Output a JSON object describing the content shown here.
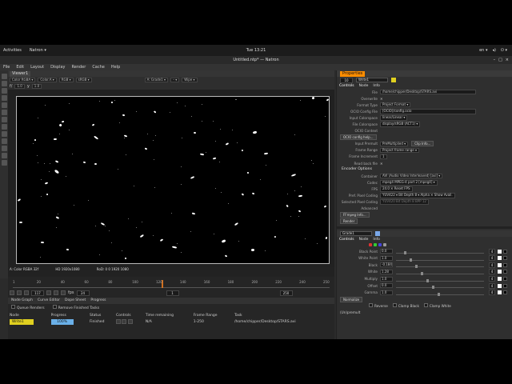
{
  "os_bar": {
    "activities": "Activities",
    "app_menu": "Natron ▾",
    "clock": "Tue 13:21",
    "tray": [
      "en ▾",
      "◂)",
      "⏻ ▾"
    ]
  },
  "window": {
    "title": "Untitled.ntp* — Natron",
    "buttons": [
      "–",
      "□",
      "×"
    ]
  },
  "menu": [
    "File",
    "Edit",
    "Layout",
    "Display",
    "Render",
    "Cache",
    "Help"
  ],
  "viewer": {
    "tab": "Viewer1",
    "row1": [
      "Color RGBA ▾",
      "Color.A ▾",
      "RGB ▾",
      "sRGB ▾"
    ],
    "row1_right": [
      "A: Grade1 ▾",
      "– ▾",
      "Wipe ▾"
    ],
    "row2": [
      "f/",
      "1.0",
      "y",
      "1.0"
    ],
    "info_left": "A: Color RGBA 32f",
    "info_mid": "HD 1920x1080",
    "info_right": "RoD: 0 0 1920 1080"
  },
  "timeline": {
    "ticks": [
      "1",
      "20",
      "40",
      "60",
      "80",
      "100",
      "120",
      "140",
      "160",
      "180",
      "200",
      "220",
      "240",
      "250"
    ],
    "current_frame_fraction": 0.47,
    "fps_label": "fps",
    "fps_value": "24",
    "frame": "117",
    "start": "1",
    "end": "250"
  },
  "progress_panel": {
    "tabs": [
      "Node Graph",
      "Curve Editor",
      "Dope Sheet",
      "Progress"
    ],
    "queue_renders": "Queue Renders",
    "remove_finished": "Remove Finished Tasks",
    "columns": [
      "Node",
      "Progress",
      "Status",
      "Controls",
      "Time remaining",
      "Frame Range",
      "Task"
    ],
    "row": {
      "node": "Write1",
      "progress": "100%",
      "status": "Finished",
      "time_remaining": "N/A",
      "frame_range": "1-250",
      "task": "/home/chipper/Desktop/STARS.avi"
    }
  },
  "properties": {
    "title": "Properties",
    "max_label": "10",
    "write_node": "Write1",
    "tabs": [
      "Controls",
      "Node",
      "Info"
    ],
    "rows": [
      {
        "label": "File",
        "value": "/home/chipper/Desktop/STARS.avi"
      },
      {
        "label": "Overwrite",
        "value": "✕"
      },
      {
        "label": "Format Type",
        "value": "Project Format ▾"
      },
      {
        "label": "OCIO Config File",
        "value": "[OCIO]/config.ocio"
      },
      {
        "label": "Input Colorspace",
        "value": "linear/Linear ▾"
      },
      {
        "label": "File Colorspace",
        "value": "display/sRGB (ACT1) ▾"
      },
      {
        "label": "OCIO Context",
        "value": ""
      }
    ],
    "ocio_help": "OCIO config help...",
    "rows2": [
      {
        "label": "Input Premult",
        "value": "PreMultiplied ▾",
        "extra": "Clip Info..."
      },
      {
        "label": "Frame Range",
        "value": "Project frame range ▾",
        "extra": ""
      },
      {
        "label": "Frame Increment",
        "value": "1",
        "extra": ""
      },
      {
        "label": "Read back file",
        "value": "✕",
        "extra": ""
      }
    ],
    "encoder_options": "Encoder Options",
    "rows3": [
      {
        "label": "Container",
        "value": "AVI (Audio Video Interleaved) [avi] ▾"
      },
      {
        "label": "Codec",
        "value": "mpeg4      MPEG-4 part 2 [mpeg4] ▾"
      },
      {
        "label": "FPS",
        "value": "24.0          ✕   Reset FPS"
      },
      {
        "label": "Pref. Pixel Coding",
        "value": "YUV422 ▾   Bit Depth 8 ▾  Alpha ✕  Show Avail."
      },
      {
        "label": "Selected Pixel Coding",
        "value": "YUV420    Bit Depth 8    BPP 12"
      },
      {
        "label": "Advanced",
        "value": ""
      }
    ],
    "ffmpeg_info": "FFmpeg Info...",
    "render_button": "Render",
    "grade_node": "Grade1",
    "grade_tabs": [
      "Controls",
      "Node",
      "Info"
    ],
    "grade_rows": [
      {
        "label": "Black Point",
        "value": "0.0"
      },
      {
        "label": "White Point",
        "value": "1.0"
      },
      {
        "label": "Black",
        "value": "-0.184"
      },
      {
        "label": "White",
        "value": "1.28"
      },
      {
        "label": "Multiply",
        "value": "1.0"
      },
      {
        "label": "Offset",
        "value": "0.0"
      },
      {
        "label": "Gamma",
        "value": "1.0"
      }
    ],
    "grade_channel_count": "4",
    "normalize_button": "Normalize",
    "reverse_label": "Reverse",
    "clamp_black": "Clamp Black",
    "clamp_white": "Clamp White",
    "unpremult": "(Un)premult"
  },
  "colors": {
    "accent": "#ff8d00",
    "progress": "#6ab0e8",
    "write_node": "#e0d020"
  }
}
